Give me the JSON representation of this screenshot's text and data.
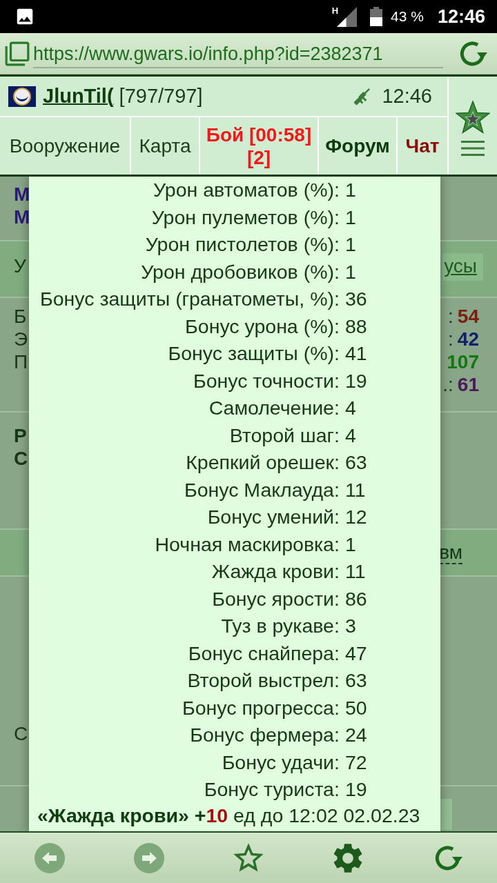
{
  "status_bar": {
    "network": "H",
    "battery": "43 %",
    "time": "12:46"
  },
  "address_bar": {
    "url": "https://www.gwars.io/info.php?id=2382371"
  },
  "header": {
    "player": "JlunTil(",
    "hp": "[797/797]",
    "time": "12:46",
    "nav": [
      {
        "label": "Вооружение",
        "kind": "normal"
      },
      {
        "label": "Карта",
        "kind": "normal"
      },
      {
        "label": "Бой [00:58] [2]",
        "kind": "battle"
      },
      {
        "label": "Форум",
        "kind": "forum"
      },
      {
        "label": "Чат",
        "kind": "chat"
      }
    ]
  },
  "page_behind": {
    "names": [
      "М",
      "М"
    ],
    "bonus_row": {
      "label": "У",
      "link": "усы"
    },
    "stat_letters": [
      "Б",
      "Э",
      "П"
    ],
    "stat_values": [
      {
        "label": ":",
        "value": "54",
        "color": "#7a1e0e"
      },
      {
        "label": ":",
        "value": "42",
        "color": "#14206a"
      },
      {
        "value": "107",
        "color": "#127812"
      },
      {
        "label": ".:",
        "value": "61",
        "color": "#4a1a5a"
      }
    ],
    "section_titles": [
      "Р",
      "С"
    ],
    "link_row": {
      "link": "вм"
    },
    "footer_text": "С"
  },
  "popup": {
    "stats": [
      {
        "label": "Урон автоматов (%):",
        "value": "1"
      },
      {
        "label": "Урон пулеметов (%):",
        "value": "1"
      },
      {
        "label": "Урон пистолетов (%):",
        "value": "1"
      },
      {
        "label": "Урон дробовиков (%):",
        "value": "1"
      },
      {
        "label": "Бонус защиты (гранатометы, %):",
        "value": "36"
      },
      {
        "label": "Бонус урона (%):",
        "value": "88"
      },
      {
        "label": "Бонус защиты (%):",
        "value": "41"
      },
      {
        "label": "Бонус точности:",
        "value": "19"
      },
      {
        "label": "Самолечение:",
        "value": "4"
      },
      {
        "label": "Второй шаг:",
        "value": "4"
      },
      {
        "label": "Крепкий орешек:",
        "value": "63"
      },
      {
        "label": "Бонус Маклауда:",
        "value": "11"
      },
      {
        "label": "Бонус умений:",
        "value": "12"
      },
      {
        "label": "Ночная маскировка:",
        "value": "1"
      },
      {
        "label": "Жажда крови:",
        "value": "11"
      },
      {
        "label": "Бонус ярости:",
        "value": "86"
      },
      {
        "label": "Туз в рукаве:",
        "value": "3"
      },
      {
        "label": "Бонус снайпера:",
        "value": "47"
      },
      {
        "label": "Второй выстрел:",
        "value": "63"
      },
      {
        "label": "Бонус прогресса:",
        "value": "50"
      },
      {
        "label": "Бонус фермера:",
        "value": "24"
      },
      {
        "label": "Бонус удачи:",
        "value": "72"
      },
      {
        "label": "Бонус туриста:",
        "value": "19"
      }
    ],
    "buff": {
      "title": "«Жажда крови» +",
      "amount": "10",
      "until": "ед до 12:02 02.02.23"
    }
  }
}
